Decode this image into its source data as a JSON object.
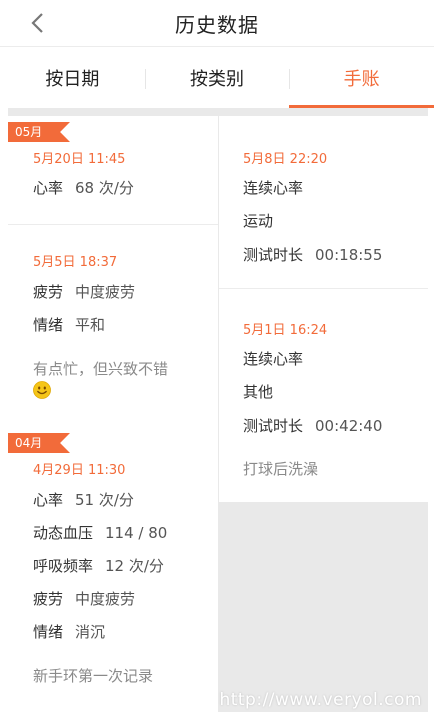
{
  "header": {
    "title": "历史数据"
  },
  "tabs": [
    {
      "label": "按日期",
      "active": false
    },
    {
      "label": "按类别",
      "active": false
    },
    {
      "label": "手账",
      "active": true
    }
  ],
  "colors": {
    "accent": "#f26b3a",
    "background": "#e9e9e9"
  },
  "left_column": {
    "months": [
      {
        "tag": "05月",
        "entries": [
          {
            "date": "5月20日 11:45",
            "rows": [
              {
                "key": "心率",
                "value": "68 次/分"
              }
            ]
          },
          {
            "date": "5月5日 18:37",
            "rows": [
              {
                "key": "疲劳",
                "value": "中度疲劳"
              },
              {
                "key": "情绪",
                "value": "平和"
              }
            ],
            "note": "有点忙，但兴致不错",
            "note_icon": "smiley-emoji-icon"
          }
        ]
      },
      {
        "tag": "04月",
        "entries": [
          {
            "date": "4月29日 11:30",
            "rows": [
              {
                "key": "心率",
                "value": "51 次/分"
              },
              {
                "key": "动态血压",
                "value": "114 / 80"
              },
              {
                "key": "呼吸频率",
                "value": "12 次/分"
              },
              {
                "key": "疲劳",
                "value": "中度疲劳"
              },
              {
                "key": "情绪",
                "value": "消沉"
              }
            ],
            "note": "新手环第一次记录"
          }
        ]
      }
    ]
  },
  "right_column": {
    "entries": [
      {
        "date": "5月8日 22:20",
        "type": "连续心率",
        "activity": "运动",
        "duration_label": "测试时长",
        "duration_value": "00:18:55"
      },
      {
        "date": "5月1日 16:24",
        "type": "连续心率",
        "activity": "其他",
        "duration_label": "测试时长",
        "duration_value": "00:42:40",
        "note": "打球后洗澡"
      }
    ]
  },
  "watermark": "http://www.veryol.com"
}
